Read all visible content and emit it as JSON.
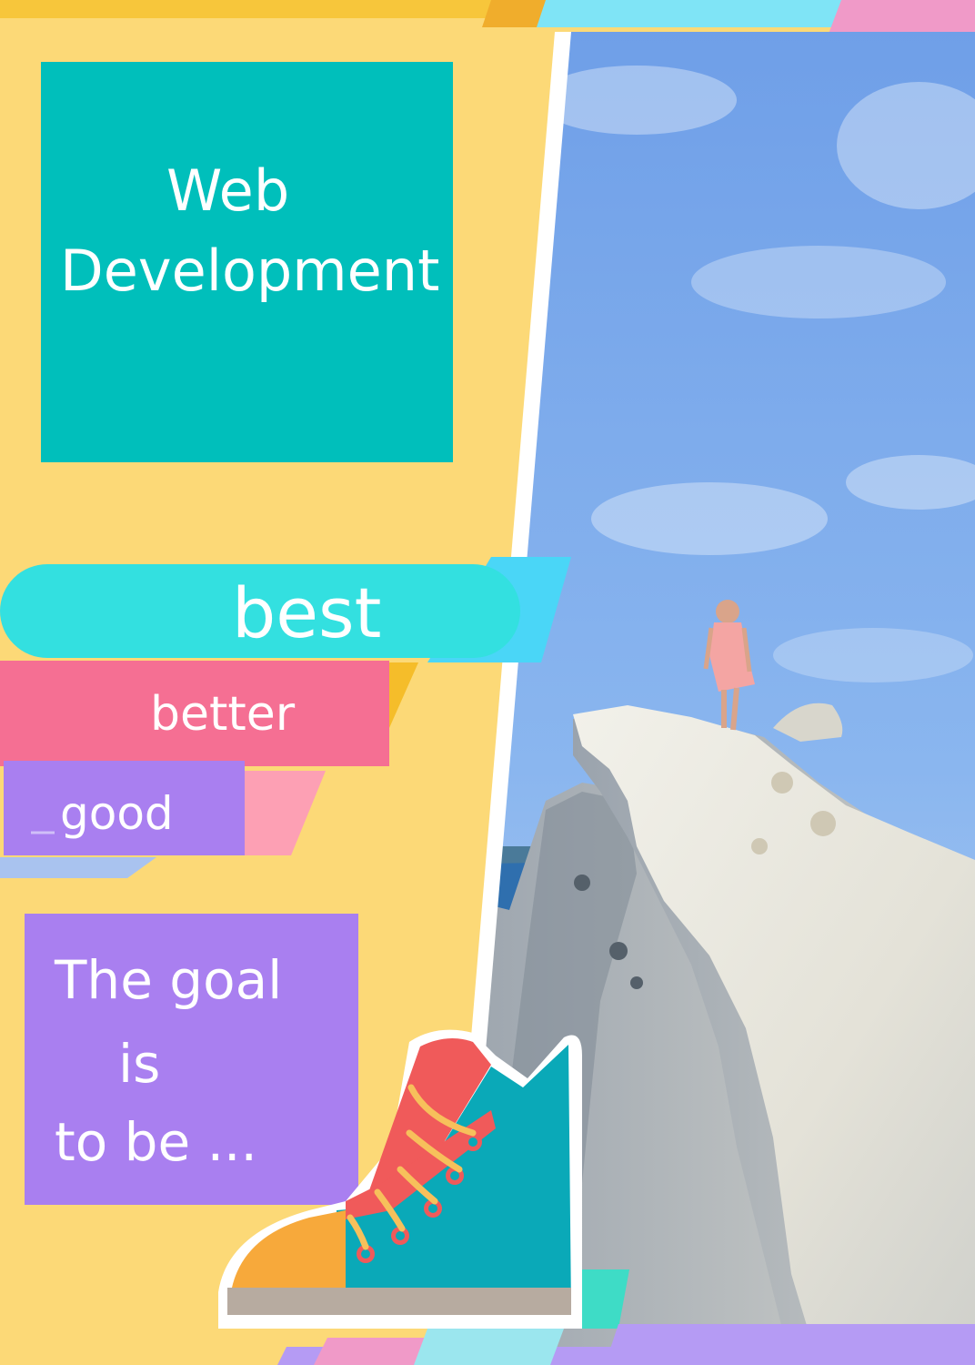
{
  "headline": {
    "line1": "Web",
    "line2": "Development"
  },
  "ladder": {
    "best": "best",
    "better": "better",
    "good": "good"
  },
  "goal": {
    "line1": "The goal",
    "line2": "is",
    "line3": "to be ..."
  },
  "colors": {
    "background": "#fcd977",
    "teal": "#00bfbb",
    "cyan_bar": "#33e0e0",
    "pink": "#f56f93",
    "purple": "#a97ff0",
    "sky": "#7aa6e6"
  },
  "icons": {
    "photo": "woman-on-rock-photo",
    "shoe": "sneaker-icon"
  }
}
